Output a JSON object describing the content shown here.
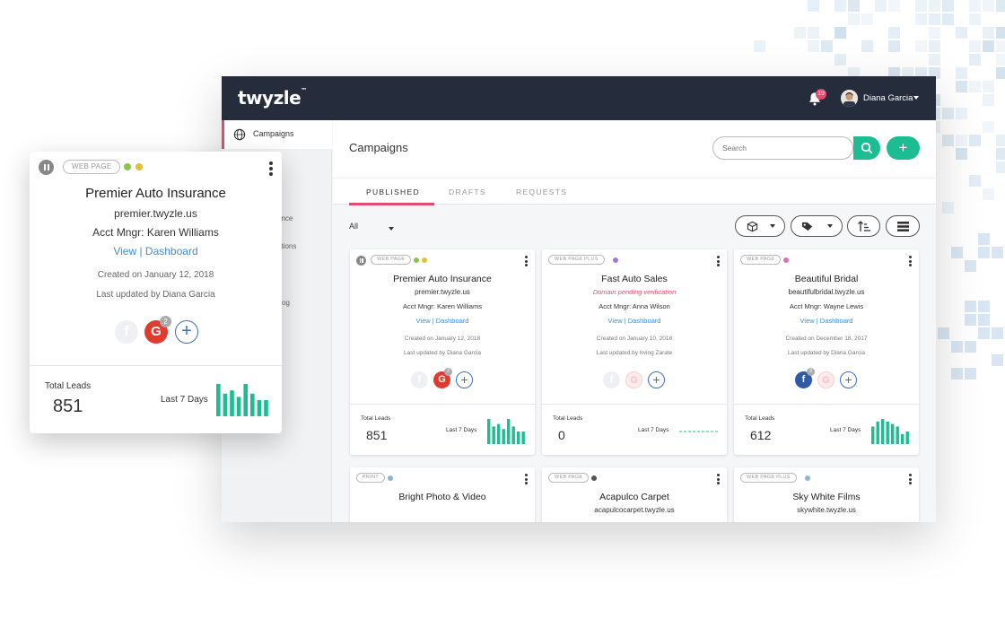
{
  "app": {
    "logo": "twyzle",
    "logo_mark": "™",
    "notification_count": "19",
    "user_name": "Diana Garcia"
  },
  "sidebar": {
    "active_item": "Campaigns",
    "partial_items": [
      "ance",
      "ations",
      "og"
    ]
  },
  "header": {
    "title": "Campaigns",
    "search_placeholder": "Search",
    "add_label": "+"
  },
  "tabs": [
    {
      "label": "PUBLISHED",
      "active": true
    },
    {
      "label": "DRAFTS",
      "active": false
    },
    {
      "label": "REQUESTS",
      "active": false
    }
  ],
  "filter": {
    "selected": "All"
  },
  "colors": {
    "accent": "#e54b6c",
    "primary": "#1cbd92",
    "topbar": "#252d3d",
    "link": "#3d8fd6",
    "spark": "#1cbd92"
  },
  "cards": [
    {
      "type": "WEB PAGE",
      "name": "Premier Auto Insurance",
      "url": "premier.twyzle.us",
      "manager": "Acct Mngr: Karen Williams",
      "links": "View | Dashboard",
      "created": "Created on January 12, 2018",
      "updated": "Last updated by Diana Garcia",
      "google_badge": "2",
      "leads_label": "Total Leads",
      "leads": "851",
      "period": "Last 7 Days",
      "spark": [
        10,
        7,
        8,
        6,
        10,
        7,
        5,
        5
      ]
    },
    {
      "type": "WEB PAGE PLUS",
      "name": "Fast Auto Sales",
      "status": "Domain pending verification",
      "manager": "Acct Mngr: Anna Wilson",
      "links": "View | Dashboard",
      "created": "Created on January 10, 2018",
      "updated": "Last updated by Irving Zarate",
      "leads_label": "Total Leads",
      "leads": "0",
      "period": "Last 7 Days",
      "spark": [
        0,
        0,
        0,
        0,
        0,
        0,
        0,
        0
      ]
    },
    {
      "type": "WEB PAGE",
      "name": "Beautiful Bridal",
      "url": "beautifulbridal.twyzle.us",
      "manager": "Acct Mngr: Wayne Lewis",
      "links": "View | Dashboard",
      "created": "Created on December 18, 2017",
      "updated": "Last updated by Diana Garcia",
      "facebook_badge": "3",
      "leads_label": "Total Leads",
      "leads": "612",
      "period": "Last 7 Days",
      "spark": [
        7,
        9,
        10,
        9,
        8,
        7,
        4,
        5
      ]
    },
    {
      "type": "PRINT",
      "name": "Bright Photo & Video"
    },
    {
      "type": "WEB PAGE",
      "name": "Acapulco Carpet",
      "url": "acapulcocarpet.twyzle.us"
    },
    {
      "type": "WEB PAGE PLUS",
      "name": "Sky White Films",
      "url": "skywhite.twyzle.us"
    }
  ],
  "zoom": {
    "type": "WEB PAGE",
    "name": "Premier Auto Insurance",
    "url": "premier.twyzle.us",
    "manager": "Acct Mngr: Karen Williams",
    "links": "View | Dashboard",
    "created": "Created on January 12, 2018",
    "updated": "Last updated by Diana Garcia",
    "google_badge": "2",
    "leads_label": "Total Leads",
    "leads": "851",
    "period": "Last 7 Days",
    "spark": [
      10,
      7,
      8,
      6,
      10,
      7,
      5,
      5
    ]
  },
  "icons": {
    "google": "G",
    "facebook": "f",
    "add": "+"
  }
}
